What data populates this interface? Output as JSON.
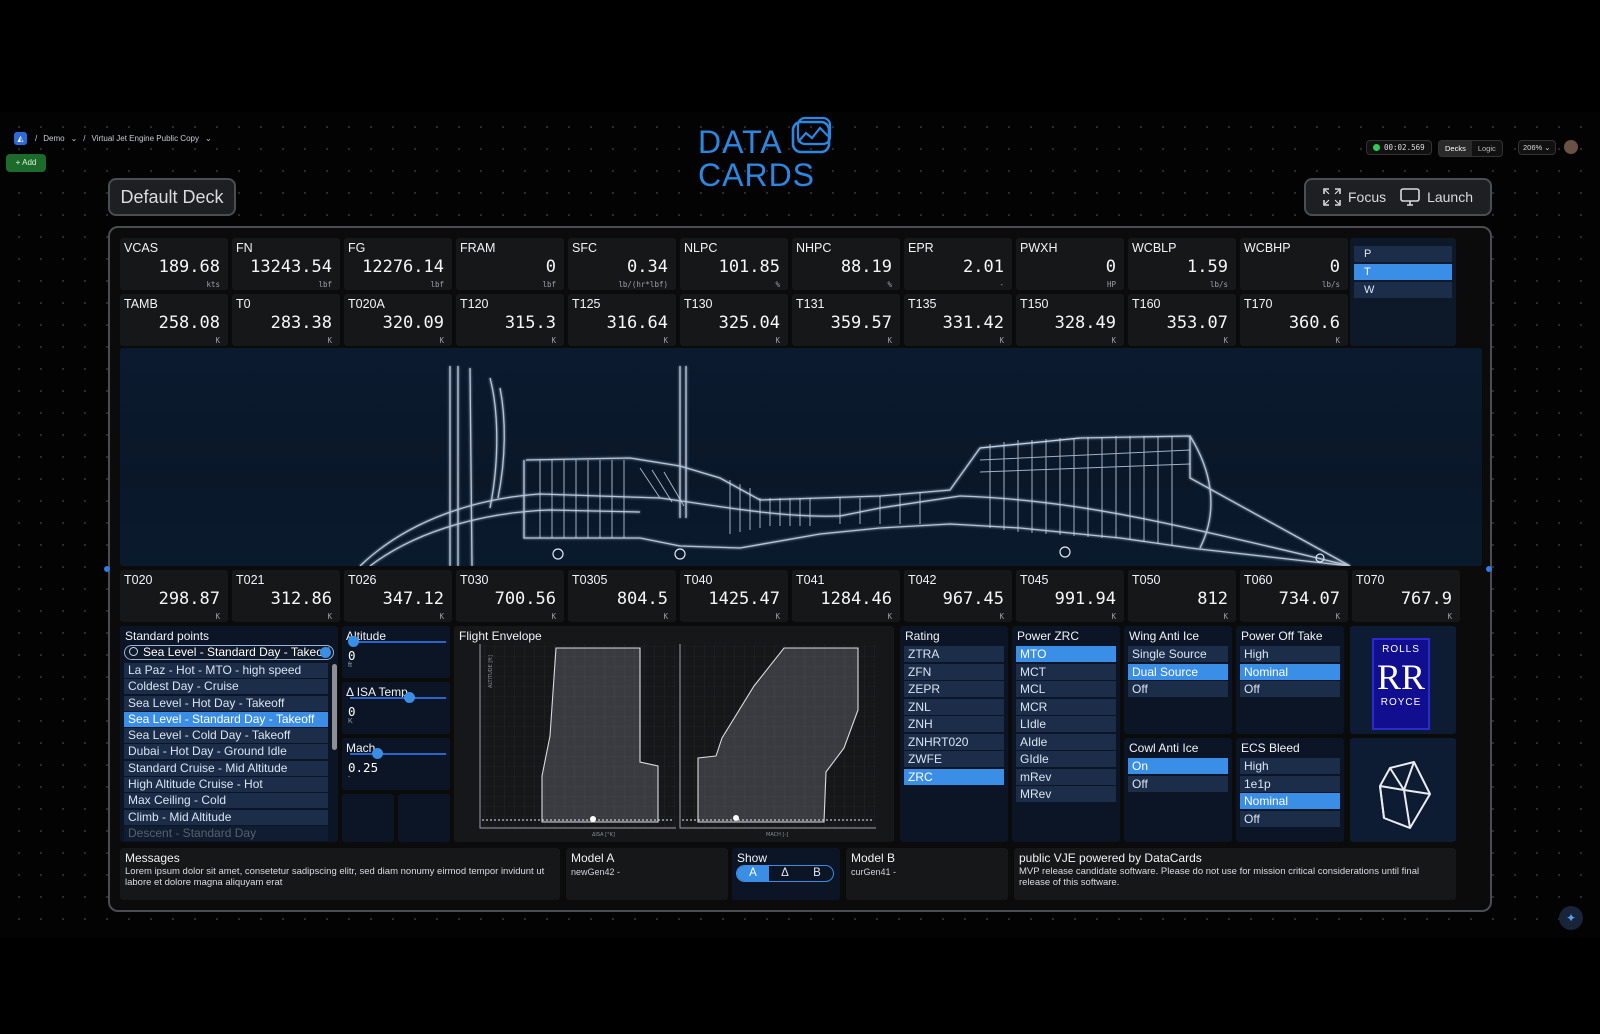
{
  "topbar": {
    "crumbs": [
      "/",
      "Demo",
      "/",
      "Virtual Jet Engine Public Copy"
    ],
    "add_label": "+ Add",
    "timer": "00:02.569",
    "view_tabs": [
      "Decks",
      "Logic"
    ],
    "zoom": "206%"
  },
  "brand": {
    "line1": "DATA",
    "line2": "CARDS"
  },
  "deck": {
    "title": "Default Deck",
    "focus_label": "Focus",
    "launch_label": "Launch"
  },
  "row1": [
    {
      "label": "VCAS",
      "value": "189.68",
      "unit": "kts"
    },
    {
      "label": "FN",
      "value": "13243.54",
      "unit": "lbf"
    },
    {
      "label": "FG",
      "value": "12276.14",
      "unit": "lbf"
    },
    {
      "label": "FRAM",
      "value": "0",
      "unit": "lbf"
    },
    {
      "label": "SFC",
      "value": "0.34",
      "unit": "lb/(hr*lbf)"
    },
    {
      "label": "NLPC",
      "value": "101.85",
      "unit": "%"
    },
    {
      "label": "NHPC",
      "value": "88.19",
      "unit": "%"
    },
    {
      "label": "EPR",
      "value": "2.01",
      "unit": "-"
    },
    {
      "label": "PWXH",
      "value": "0",
      "unit": "HP"
    },
    {
      "label": "WCBLP",
      "value": "1.59",
      "unit": "lb/s"
    },
    {
      "label": "WCBHP",
      "value": "0",
      "unit": "lb/s"
    }
  ],
  "row2": [
    {
      "label": "TAMB",
      "value": "258.08",
      "unit": "K"
    },
    {
      "label": "T0",
      "value": "283.38",
      "unit": "K"
    },
    {
      "label": "T020A",
      "value": "320.09",
      "unit": "K"
    },
    {
      "label": "T120",
      "value": "315.3",
      "unit": "K"
    },
    {
      "label": "T125",
      "value": "316.64",
      "unit": "K"
    },
    {
      "label": "T130",
      "value": "325.04",
      "unit": "K"
    },
    {
      "label": "T131",
      "value": "359.57",
      "unit": "K"
    },
    {
      "label": "T135",
      "value": "331.42",
      "unit": "K"
    },
    {
      "label": "T150",
      "value": "328.49",
      "unit": "K"
    },
    {
      "label": "T160",
      "value": "353.07",
      "unit": "K"
    },
    {
      "label": "T170",
      "value": "360.6",
      "unit": "K"
    }
  ],
  "ptw": {
    "options": [
      "P",
      "T",
      "W"
    ],
    "selected": 1
  },
  "row3": [
    {
      "label": "T020",
      "value": "298.87",
      "unit": "K"
    },
    {
      "label": "T021",
      "value": "312.86",
      "unit": "K"
    },
    {
      "label": "T026",
      "value": "347.12",
      "unit": "K"
    },
    {
      "label": "T030",
      "value": "700.56",
      "unit": "K"
    },
    {
      "label": "T0305",
      "value": "804.5",
      "unit": "K"
    },
    {
      "label": "T040",
      "value": "1425.47",
      "unit": "K"
    },
    {
      "label": "T041",
      "value": "1284.46",
      "unit": "K"
    },
    {
      "label": "T042",
      "value": "967.45",
      "unit": "K"
    },
    {
      "label": "T045",
      "value": "991.94",
      "unit": "K"
    },
    {
      "label": "T050",
      "value": "812",
      "unit": "K"
    },
    {
      "label": "T060",
      "value": "734.07",
      "unit": "K"
    },
    {
      "label": "T070",
      "value": "767.9",
      "unit": "K"
    }
  ],
  "standard_points": {
    "title": "Standard points",
    "search_value": "Sea Level - Standard Day - Takeoff",
    "items": [
      "La Paz - Hot - MTO - high speed",
      "Coldest Day - Cruise",
      "Sea Level - Hot Day - Takeoff",
      "Sea Level - Standard Day - Takeoff",
      "Sea Level - Cold Day - Takeoff",
      "Dubai - Hot Day - Ground Idle",
      "Standard Cruise - Mid Altitude",
      "High Altitude Cruise - Hot",
      "Max Ceiling - Cold",
      "Climb - Mid Altitude",
      "Descent - Standard Day"
    ],
    "selected": 3
  },
  "sliders": [
    {
      "title": "Altitude",
      "value": "0",
      "unit": "ft",
      "level": 0.04
    },
    {
      "title": "Δ ISA Temp",
      "value": "0",
      "unit": "K",
      "level": 0.6
    },
    {
      "title": "Mach",
      "value": "0.25",
      "unit": "-",
      "level": 0.28
    }
  ],
  "flight_envelope": {
    "title": "Flight Envelope",
    "xlabel1": "ΔISA [°K]",
    "xlabel2": "MACH [-]",
    "ylabel": "ALTITUDE [ft]"
  },
  "rating": {
    "title": "Rating",
    "items": [
      "ZTRA",
      "ZFN",
      "ZEPR",
      "ZNL",
      "ZNH",
      "ZNHRT020",
      "ZWFE",
      "ZRC"
    ],
    "selected": 7
  },
  "power_zrc": {
    "title": "Power ZRC",
    "items": [
      "MTO",
      "MCT",
      "MCL",
      "MCR",
      "LIdle",
      "AIdle",
      "GIdle",
      "mRev",
      "MRev"
    ],
    "selected": 0
  },
  "wing_anti_ice": {
    "title": "Wing Anti Ice",
    "items": [
      "Single Source",
      "Dual Source",
      "Off"
    ],
    "selected": 1
  },
  "power_off_take": {
    "title": "Power Off Take",
    "items": [
      "High",
      "Nominal",
      "Off"
    ],
    "selected": 1
  },
  "cowl_anti_ice": {
    "title": "Cowl Anti Ice",
    "items": [
      "On",
      "Off"
    ],
    "selected": 0
  },
  "ecs_bleed": {
    "title": "ECS Bleed",
    "items": [
      "High",
      "1e1p",
      "Nominal",
      "Off"
    ],
    "selected": 2
  },
  "rolls_royce": {
    "line1": "ROLLS",
    "mono": "RR",
    "line3": "ROYCE"
  },
  "messages": {
    "title": "Messages",
    "text": "Lorem ipsum dolor sit amet, consetetur sadipscing elitr, sed diam nonumy eirmod tempor invidunt ut labore et dolore magna aliquyam erat"
  },
  "model_a": {
    "title": "Model A",
    "value": "newGen42 -"
  },
  "show": {
    "title": "Show",
    "options": [
      "A",
      "Δ",
      "B"
    ],
    "selected": 0
  },
  "model_b": {
    "title": "Model B",
    "value": "curGen41 -"
  },
  "footer_note": {
    "title": "public VJE powered by DataCards",
    "text": "MVP release candidate software. Please do not use for mission critical considerations until final release of this software."
  },
  "colors": {
    "accent": "#3a8ee6",
    "brand": "#2d86e0",
    "option": "#1b2d48",
    "card": "#161719"
  }
}
